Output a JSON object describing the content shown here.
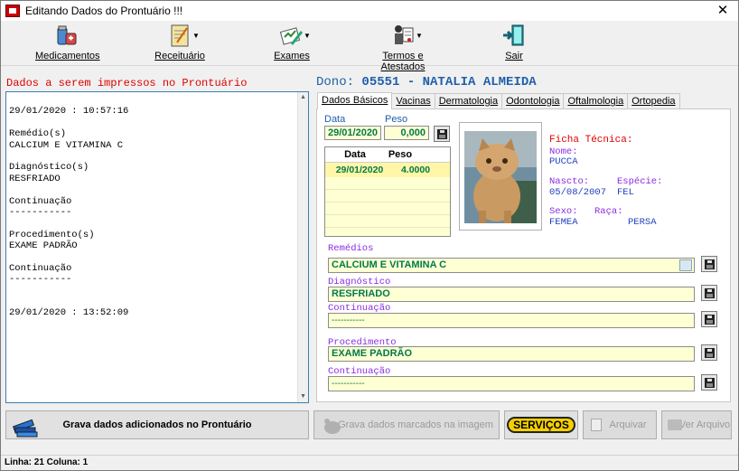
{
  "window": {
    "title": "Editando Dados do Prontuário !!!",
    "close_glyph": "✕"
  },
  "toolbar": {
    "medicamentos": "Medicamentos",
    "receituario": "Receituário",
    "exames": "Exames",
    "termos": "Termos e Atestados",
    "sair": "Sair"
  },
  "left": {
    "heading": "Dados a serem impressos no Prontuário",
    "lines": [
      "",
      "29/01/2020 : 10:57:16",
      "",
      "Remédio(s)",
      "CALCIUM E VITAMINA C",
      "",
      "Diagnóstico(s)",
      "RESFRIADO",
      "",
      "Continuação",
      "-----------",
      "",
      "Procedimento(s)",
      "EXAME PADRÃO",
      "",
      "Continuação",
      "-----------",
      "",
      "",
      "29/01/2020 : 13:52:09"
    ]
  },
  "owner": {
    "label": "Dono:",
    "value": "05551 - NATALIA ALMEIDA"
  },
  "tabs": [
    "Dados Básicos",
    "Vacinas",
    "Dermatologia",
    "Odontologia",
    "Oftalmologia",
    "Ortopedia"
  ],
  "basic": {
    "data_label": "Data",
    "peso_label": "Peso",
    "data_value": "29/01/2020",
    "peso_value": "0,000",
    "grid_headers": [
      "Data",
      "Peso"
    ],
    "grid_rows": [
      {
        "data": "29/01/2020",
        "peso": "4.0000"
      }
    ]
  },
  "ficha": {
    "title": "Ficha Técnica:",
    "nome_label": "Nome:",
    "nome": "PUCCA",
    "nasc_label": "Nascto:",
    "nasc": "05/08/2007",
    "especie_label": "Espécie:",
    "especie": "FEL",
    "sexo_label": "Sexo:",
    "sexo": "FEMEA",
    "raca_label": "Raça:",
    "raca": "PERSA"
  },
  "fields": {
    "remedios_label": "Remédios",
    "remedios": "CALCIUM E VITAMINA C",
    "diagnostico_label": "Diagnóstico",
    "diagnostico": "RESFRIADO",
    "continuacao1_label": "Continuação",
    "continuacao1": "-----------",
    "procedimento_label": "Procedimento",
    "procedimento": "EXAME PADRÃO",
    "continuacao2_label": "Continuação",
    "continuacao2": "-----------"
  },
  "buttons": {
    "grava": "Grava dados adicionados no Prontuário",
    "grava_img": "Grava dados marcados na imagem",
    "servicos": "SERVIÇOS",
    "arquivar": "Arquivar",
    "ver_arquivo": "Ver Arquivo"
  },
  "status": {
    "text": "Linha: 21 Coluna: 1"
  }
}
